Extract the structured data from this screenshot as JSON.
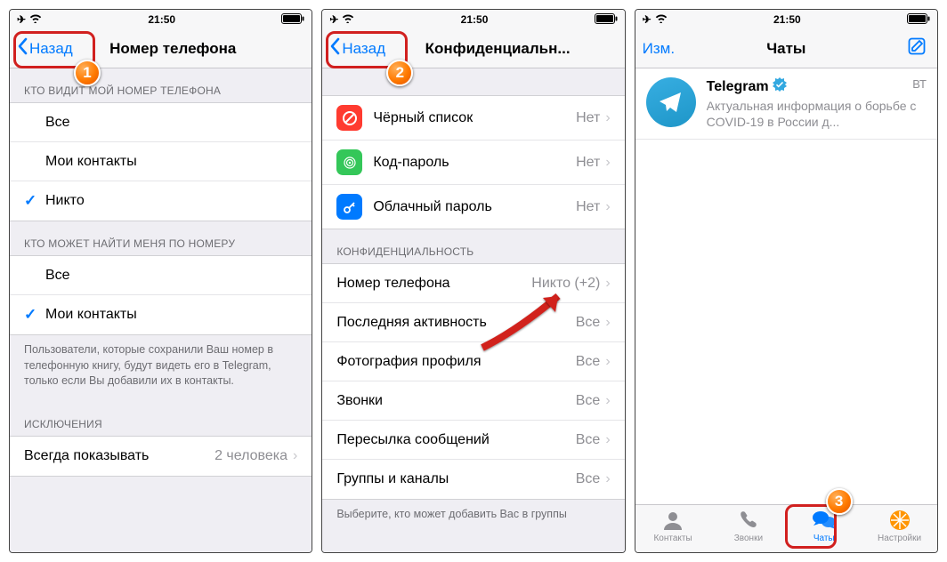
{
  "status": {
    "time": "21:50"
  },
  "screen1": {
    "back": "Назад",
    "title": "Номер телефона",
    "section_who_sees": "КТО ВИДИТ МОЙ НОМЕР ТЕЛЕФОНА",
    "opts_who_sees": [
      {
        "label": "Все",
        "checked": false
      },
      {
        "label": "Мои контакты",
        "checked": false
      },
      {
        "label": "Никто",
        "checked": true
      }
    ],
    "section_who_finds": "КТО МОЖЕТ НАЙТИ МЕНЯ ПО НОМЕРУ",
    "opts_who_finds": [
      {
        "label": "Все",
        "checked": false
      },
      {
        "label": "Мои контакты",
        "checked": true
      }
    ],
    "footer_hint": "Пользователи, которые сохранили Ваш номер в телефонную книгу, будут видеть его в Telegram, только если Вы добавили их в контакты.",
    "section_exceptions": "ИСКЛЮЧЕНИЯ",
    "exception_row": {
      "label": "Всегда показывать",
      "detail": "2 человека"
    }
  },
  "screen2": {
    "back": "Назад",
    "title": "Конфиденциальн...",
    "security_rows": [
      {
        "icon": "block",
        "color": "#ff3b30",
        "label": "Чёрный список",
        "detail": "Нет"
      },
      {
        "icon": "touchid",
        "color": "#34c759",
        "label": "Код-пароль",
        "detail": "Нет"
      },
      {
        "icon": "key",
        "color": "#007aff",
        "label": "Облачный пароль",
        "detail": "Нет"
      }
    ],
    "section_privacy": "КОНФИДЕНЦИАЛЬНОСТЬ",
    "privacy_rows": [
      {
        "label": "Номер телефона",
        "detail": "Никто (+2)"
      },
      {
        "label": "Последняя активность",
        "detail": "Все"
      },
      {
        "label": "Фотография профиля",
        "detail": "Все"
      },
      {
        "label": "Звонки",
        "detail": "Все"
      },
      {
        "label": "Пересылка сообщений",
        "detail": "Все"
      },
      {
        "label": "Группы и каналы",
        "detail": "Все"
      }
    ],
    "footer_hint": "Выберите, кто может добавить Вас в группы"
  },
  "screen3": {
    "edit": "Изм.",
    "title": "Чаты",
    "chat": {
      "name": "Telegram",
      "verified": true,
      "time": "ВТ",
      "preview": "Актуальная информация о борьбе с COVID-19 в России д..."
    },
    "tabs": [
      {
        "label": "Контакты",
        "icon": "contacts",
        "active": false
      },
      {
        "label": "Звонки",
        "icon": "calls",
        "active": false
      },
      {
        "label": "Чаты",
        "icon": "chats",
        "active": true
      },
      {
        "label": "Настройки",
        "icon": "settings",
        "active": false
      }
    ]
  },
  "callouts": {
    "one": "1",
    "two": "2",
    "three": "3"
  }
}
